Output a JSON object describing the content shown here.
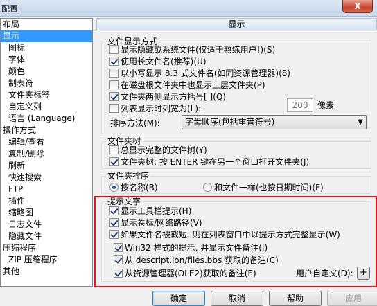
{
  "window": {
    "title": "配置",
    "close_label": "X"
  },
  "sidebar": {
    "items": [
      {
        "label": "布局",
        "level": 0
      },
      {
        "label": "显示",
        "level": 0
      },
      {
        "label": "图标",
        "level": 1
      },
      {
        "label": "字体",
        "level": 1
      },
      {
        "label": "颜色",
        "level": 1
      },
      {
        "label": "制表符",
        "level": 1
      },
      {
        "label": "文件夹标签",
        "level": 1
      },
      {
        "label": "自定义列",
        "level": 1
      },
      {
        "label": "语言 (Language)",
        "level": 1
      },
      {
        "label": "操作方式",
        "level": 0
      },
      {
        "label": "编辑/查看",
        "level": 1
      },
      {
        "label": "复制/删除",
        "level": 1
      },
      {
        "label": "刷新",
        "level": 1
      },
      {
        "label": "快速搜索",
        "level": 1
      },
      {
        "label": "FTP",
        "level": 1
      },
      {
        "label": "插件",
        "level": 1
      },
      {
        "label": "缩略图",
        "level": 1
      },
      {
        "label": "日志文件",
        "level": 1
      },
      {
        "label": "隐藏文件",
        "level": 1
      },
      {
        "label": "压缩程序",
        "level": 0
      },
      {
        "label": "ZIP 压缩程序",
        "level": 1
      },
      {
        "label": "其他",
        "level": 0
      }
    ]
  },
  "panel": {
    "title": "显示"
  },
  "file_display": {
    "label": "文件显示方式",
    "options": [
      {
        "label": "显示隐藏或系统文件(仅适于熟练用户!)(S)",
        "checked": false
      },
      {
        "label": "使用长文件名(推荐)(U)",
        "checked": true
      },
      {
        "label": "以小写显示 8.3 式文件名(如同资源管理器)(8)",
        "checked": false
      },
      {
        "label": "在磁盘根文件夹中也显示上层文件夹(P)",
        "checked": false
      },
      {
        "label": "文件夹两侧显示方括号[ ](Q)",
        "checked": true
      },
      {
        "label": "列表显示时列宽为(L):",
        "checked": false
      }
    ],
    "column_width": "200",
    "column_width_unit": "像素",
    "sort_label": "排序方法(M):",
    "sort_value": "字母顺序(包括重音符号)"
  },
  "folder_tree": {
    "label": "文件夹树",
    "options": [
      {
        "label": "总显示完整的文件树(Y)",
        "checked": false
      },
      {
        "label": "文件夹树: 按 ENTER 键在另一个窗口打开文件夹(J)",
        "checked": true
      }
    ]
  },
  "folder_sort": {
    "label": "文件夹排序",
    "options": [
      {
        "label": "按名称(B)",
        "checked": true
      },
      {
        "label": "和文件一样(也按日期时间)(F)",
        "checked": false
      }
    ]
  },
  "tooltips": {
    "label": "提示文字",
    "options": [
      {
        "label": "显示工具栏提示(H)",
        "checked": true
      },
      {
        "label": "显示卷标/网络路径(V)",
        "checked": true
      },
      {
        "label": "如果文件名被截短, 则在列表窗口中以提示方式完整显示(W)",
        "checked": true
      },
      {
        "label": "Win32 样式的提示, 并显示文件备注(I)",
        "checked": true
      },
      {
        "label": "从 descript.ion/files.bbs 获取的备注(C)",
        "checked": true
      },
      {
        "label": "从资源管理器(OLE2)获取的备注(E)",
        "checked": true
      }
    ],
    "custom_label": "用户自定义(D):",
    "custom_button": "+"
  },
  "buttons": {
    "ok": "确定",
    "cancel": "取消",
    "help": "帮助",
    "apply": "应用"
  },
  "colors": {
    "selection": "#3399ff",
    "highlight_border": "#e4141b"
  }
}
